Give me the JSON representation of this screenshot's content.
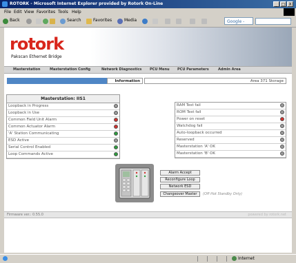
{
  "window": {
    "title": "ROTORK - Microsoft Internet Explorer provided by Rotork On-Line",
    "controls": [
      "_",
      "□",
      "X"
    ]
  },
  "menu": [
    "File",
    "Edit",
    "View",
    "Favorites",
    "Tools",
    "Help"
  ],
  "toolbar": {
    "back": "Back",
    "search": "Search",
    "favorites": "Favorites",
    "media": "Media",
    "google": "Google -"
  },
  "banner": {
    "logo": "rotork",
    "tagline": "Pakscan Ethernet Bridge"
  },
  "nav": [
    "Masterstation",
    "Masterstation Config",
    "Network Diagnostics",
    "PCU Menu",
    "PCU Parameters",
    "Admin Area"
  ],
  "info": {
    "label": "Information",
    "location": "Area 371 Storage"
  },
  "left_panel": {
    "title": "Masterstation: IIS1",
    "rows": [
      {
        "label": "Loopback in Progress",
        "status": "gray"
      },
      {
        "label": "Loopback in Use",
        "status": "gray"
      },
      {
        "label": "Common Field Unit Alarm",
        "status": "red"
      },
      {
        "label": "Common Actuator Alarm",
        "status": "red"
      },
      {
        "label": "'A' Station Communicating",
        "status": "green"
      },
      {
        "label": "ESD Active",
        "status": "gray"
      },
      {
        "label": "Serial Control Enabled",
        "status": "green"
      },
      {
        "label": "Loop Commands Active",
        "status": "green"
      }
    ]
  },
  "right_panel": {
    "rows": [
      {
        "label": "RAM Test fail",
        "status": "gray"
      },
      {
        "label": "ROM Test fail",
        "status": "gray"
      },
      {
        "label": "Power on reset",
        "status": "red"
      },
      {
        "label": "Watchdog fail",
        "status": "gray"
      },
      {
        "label": "Auto-loopback occurred",
        "status": "gray"
      },
      {
        "label": "Reserved",
        "status": "gray"
      },
      {
        "label": "Masterstation 'A' OK",
        "status": "gray"
      },
      {
        "label": "Masterstation 'B' OK",
        "status": "gray"
      }
    ]
  },
  "buttons": [
    "Alarm Accept",
    "Reconfigure Loop",
    "Network ESD",
    "Changeover Master"
  ],
  "standby_note": "(Off Hot Standby Only)",
  "footer": {
    "firmware": "Firmware ver.: 0.55.0",
    "copyright": "powered by rotork.net"
  },
  "status": {
    "zone": "Internet"
  },
  "colors": {
    "green": "#2e9e3e",
    "red": "#d0312d",
    "gray": "#9a9a9a",
    "brand_red": "#d8261c",
    "info_blue": "#4f86c5"
  }
}
